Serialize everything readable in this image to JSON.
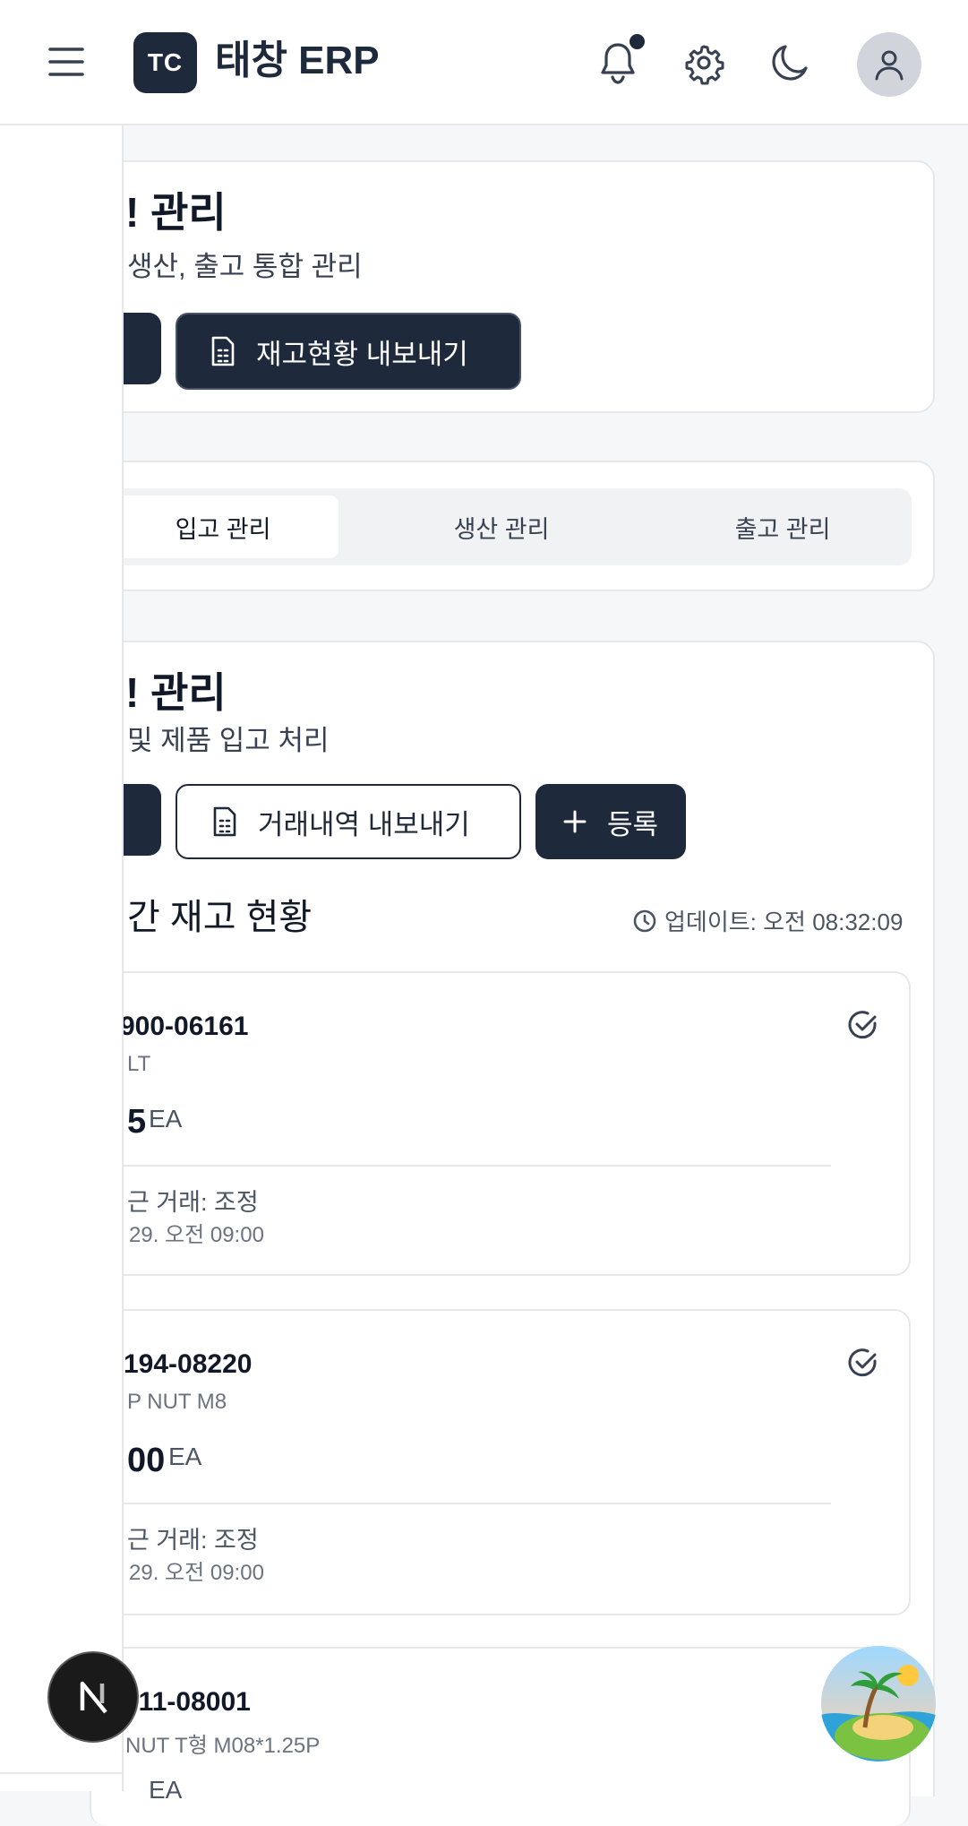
{
  "header": {
    "logo_text": "TC",
    "app_title": "태창 ERP"
  },
  "page_header": {
    "title_partial": "! 관리",
    "subtitle_partial": "생산, 출고 통합 관리",
    "export_button": "재고현황 내보내기"
  },
  "tabs": [
    {
      "label": "입고 관리",
      "active": true
    },
    {
      "label": "생산 관리",
      "active": false
    },
    {
      "label": "출고 관리",
      "active": false
    }
  ],
  "section": {
    "title_partial": "! 관리",
    "subtitle_partial": "및 제품 입고 처리",
    "export_tx_button": "거래내역 내보내기",
    "add_button": "등록"
  },
  "stock": {
    "title_partial": "간 재고 현황",
    "updated": "업데이트: 오전 08:32:09",
    "items": [
      {
        "code": "900-06161",
        "name": "LT",
        "qty": "5",
        "unit": "EA",
        "recent": "근 거래: 조정",
        "date": "29. 오전 09:00"
      },
      {
        "code": "194-08220",
        "name": "P NUT M8",
        "qty": "00",
        "unit": "EA",
        "recent": "근 거래: 조정",
        "date": "29. 오전 09:00"
      },
      {
        "code": "911-08001",
        "name": "NUT T형 M08*1.25P",
        "qty": "",
        "unit": "EA",
        "recent": "",
        "date": ""
      }
    ]
  },
  "colors": {
    "primary": "#1e293b",
    "background": "#f6f7f9",
    "border": "#e5e7eb"
  },
  "icons": [
    "menu-icon",
    "bell-icon",
    "gear-icon",
    "moon-icon",
    "user-icon",
    "spreadsheet-icon",
    "plus-icon",
    "clock-icon",
    "check-circle-icon",
    "nextjs-icon",
    "island-icon"
  ]
}
